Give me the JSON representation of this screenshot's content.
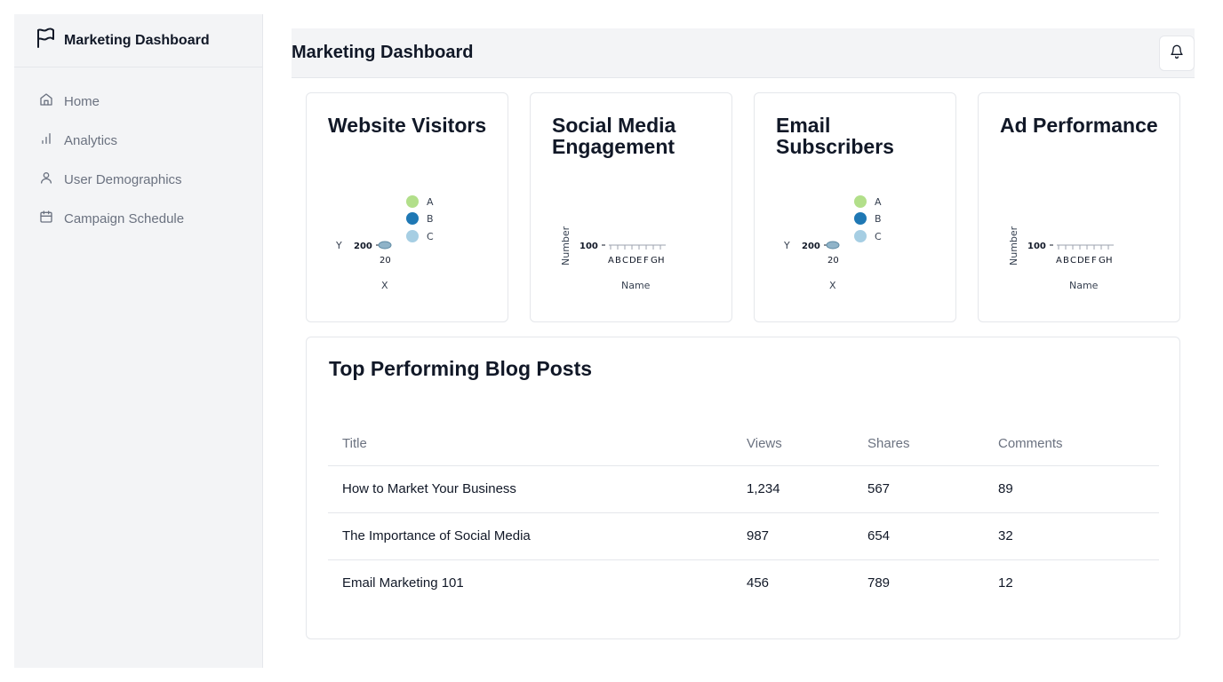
{
  "sidebar": {
    "brand": "Marketing Dashboard",
    "items": [
      {
        "label": "Home",
        "icon": "home-icon"
      },
      {
        "label": "Analytics",
        "icon": "bar-chart-icon"
      },
      {
        "label": "User Demographics",
        "icon": "user-icon"
      },
      {
        "label": "Campaign Schedule",
        "icon": "calendar-icon"
      }
    ]
  },
  "header": {
    "title": "Marketing Dashboard",
    "bell_icon": "bell-icon"
  },
  "cards": [
    {
      "title": "Website Visitors"
    },
    {
      "title": "Social Media Engagement"
    },
    {
      "title": "Email Subscribers"
    },
    {
      "title": "Ad Performance"
    }
  ],
  "chart_data": [
    {
      "type": "scatter",
      "title": "Website Visitors",
      "xlabel": "X",
      "ylabel": "Y",
      "legend": [
        "A",
        "B",
        "C"
      ],
      "legend_position": "top-right",
      "colors": {
        "A": "#b2df8a",
        "B": "#1f78b4",
        "C": "#a6cee3"
      },
      "ytick": "200",
      "xtick": "20"
    },
    {
      "type": "bar",
      "title": "Social Media Engagement",
      "xlabel": "Name",
      "ylabel": "Number",
      "categories": [
        "A",
        "B",
        "C",
        "D",
        "E",
        "F",
        "G",
        "H"
      ],
      "ytick": "100"
    },
    {
      "type": "scatter",
      "title": "Email Subscribers",
      "xlabel": "X",
      "ylabel": "Y",
      "legend": [
        "A",
        "B",
        "C"
      ],
      "legend_position": "top-right",
      "colors": {
        "A": "#b2df8a",
        "B": "#1f78b4",
        "C": "#a6cee3"
      },
      "ytick": "200",
      "xtick": "20"
    },
    {
      "type": "bar",
      "title": "Ad Performance",
      "xlabel": "Name",
      "ylabel": "Number",
      "categories": [
        "A",
        "B",
        "C",
        "D",
        "E",
        "F",
        "G",
        "H"
      ],
      "ytick": "100"
    }
  ],
  "blog": {
    "title": "Top Performing Blog Posts",
    "columns": [
      "Title",
      "Views",
      "Shares",
      "Comments"
    ],
    "rows": [
      [
        "How to Market Your Business",
        "1,234",
        "567",
        "89"
      ],
      [
        "The Importance of Social Media",
        "987",
        "654",
        "32"
      ],
      [
        "Email Marketing 101",
        "456",
        "789",
        "12"
      ]
    ]
  }
}
